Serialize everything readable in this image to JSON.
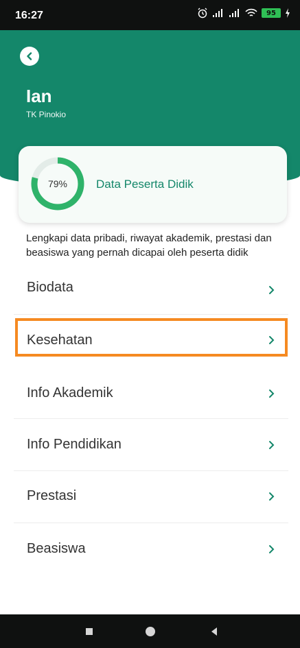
{
  "status_bar": {
    "time": "16:27",
    "battery": "95",
    "icons": [
      "alarm-icon",
      "signal-icon",
      "signal-icon",
      "wifi-icon",
      "battery-icon",
      "charging-icon"
    ]
  },
  "header": {
    "name": "Ian",
    "school": "TK Pinokio",
    "back_icon": "chevron-left-icon"
  },
  "progress_card": {
    "percent_label": "79%",
    "percent_value": 79,
    "title": "Data Peserta Didik"
  },
  "description": "Lengkapi data pribadi, riwayat akademik, prestasi dan beasiswa yang pernah dicapai oleh peserta didik",
  "menu": [
    {
      "label": "Biodata"
    },
    {
      "label": "Kesehatan"
    },
    {
      "label": "Info Akademik"
    },
    {
      "label": "Info Pendidikan"
    },
    {
      "label": "Prestasi"
    },
    {
      "label": "Beasiswa"
    }
  ],
  "highlighted_item": "Kesehatan",
  "colors": {
    "brand_green": "#14876a",
    "highlight_orange": "#f58a22"
  },
  "nav_bar": [
    "square-icon",
    "circle-icon",
    "triangle-back-icon"
  ]
}
